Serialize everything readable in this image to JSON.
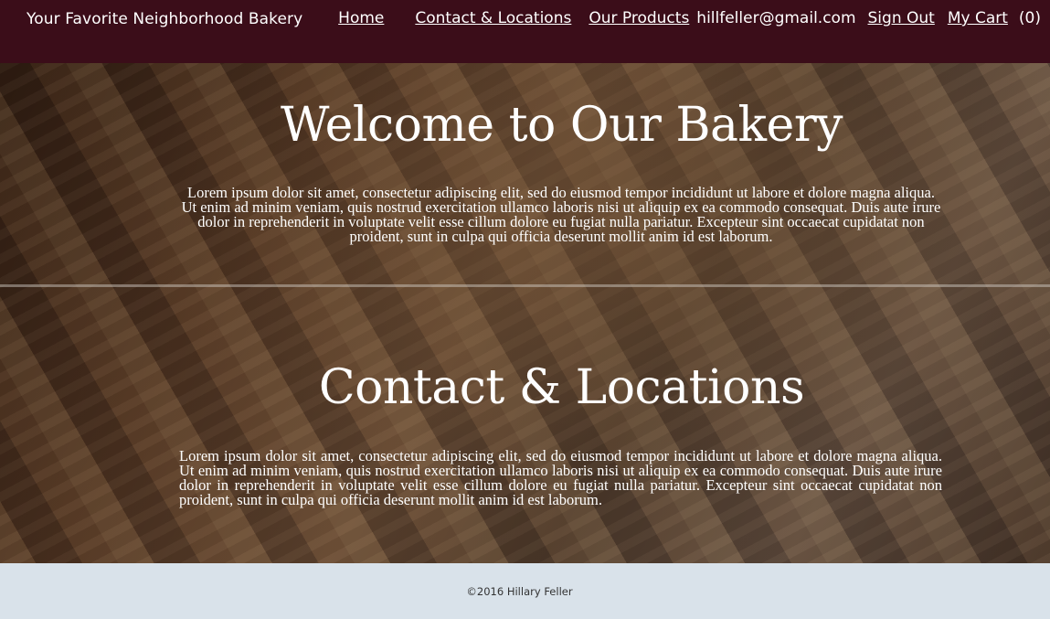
{
  "nav": {
    "brand": "Your Favorite Neighborhood Bakery",
    "home": "Home",
    "contact": "Contact & Locations",
    "products": "Our Products",
    "email": "hillfeller@gmail.com",
    "sign_out": "Sign Out",
    "cart": "My Cart",
    "cart_count": "(0)"
  },
  "sections": [
    {
      "title": "Welcome to Our Bakery",
      "body": "Lorem ipsum dolor sit amet, consectetur adipiscing elit, sed do eiusmod tempor incididunt ut labore et dolore magna aliqua. Ut enim ad minim veniam, quis nostrud exercitation ullamco laboris nisi ut aliquip ex ea commodo consequat. Duis aute irure dolor in reprehenderit in voluptate velit esse cillum dolore eu fugiat nulla pariatur. Excepteur sint occaecat cupidatat non proident, sunt in culpa qui officia deserunt mollit anim id est laborum."
    },
    {
      "title": "Contact & Locations",
      "body": "Lorem ipsum dolor sit amet, consectetur adipiscing elit, sed do eiusmod tempor incididunt ut labore et dolore magna aliqua. Ut enim ad minim veniam, quis nostrud exercitation ullamco laboris nisi ut aliquip ex ea commodo consequat. Duis aute irure dolor in reprehenderit in voluptate velit esse cillum dolore eu fugiat nulla pariatur. Excepteur sint occaecat cupidatat non proident, sunt in culpa qui officia deserunt mollit anim id est laborum."
    }
  ],
  "footer": {
    "copyright": "©2016 Hillary Feller"
  },
  "colors": {
    "nav_bg": "#3b0d19",
    "footer_bg": "#d9e2ea",
    "text_light": "#ffffff"
  },
  "background_image": "bread-loaves-on-paper"
}
